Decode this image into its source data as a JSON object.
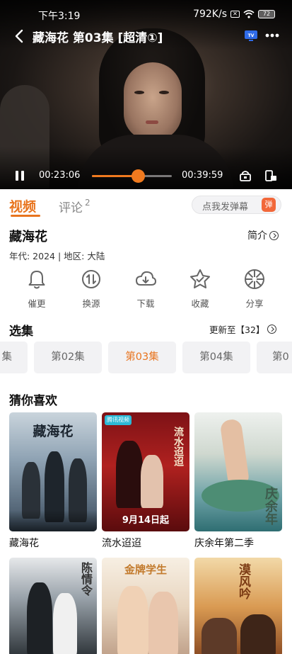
{
  "status_bar": {
    "time": "下午3:19",
    "net_speed": "792K/s",
    "battery": "72"
  },
  "player": {
    "title": "藏海花 第03集 [超清①]",
    "current_time": "00:23:06",
    "total_time": "00:39:59",
    "progress": 0.578,
    "tv_label": "TV"
  },
  "tabs": {
    "video": "视频",
    "comments": "评论",
    "comments_count": "2",
    "danmaku_placeholder": "点我发弹幕",
    "danmaku_icon": "弹"
  },
  "show": {
    "title": "藏海花",
    "intro_label": "简介",
    "meta": "年代: 2024 | 地区: 大陆"
  },
  "actions": [
    {
      "label": "催更",
      "icon": "bell-icon"
    },
    {
      "label": "换源",
      "icon": "switch-source-icon"
    },
    {
      "label": "下载",
      "icon": "cloud-download-icon"
    },
    {
      "label": "收藏",
      "icon": "star-icon"
    },
    {
      "label": "分享",
      "icon": "shutter-share-icon"
    }
  ],
  "episodes": {
    "title": "选集",
    "update_label": "更新至【32】",
    "items": [
      "集",
      "第02集",
      "第03集",
      "第04集",
      "第0"
    ],
    "active_index": 2
  },
  "recommendations": {
    "title": "猜你喜欢",
    "items": [
      {
        "name": "藏海花",
        "poster_text": "藏海花",
        "poster_caption": ""
      },
      {
        "name": "流水迢迢",
        "poster_text": "流水迢迢",
        "poster_caption": "9月14日起",
        "badge": "腾讯视频"
      },
      {
        "name": "庆余年第二季",
        "poster_text": "庆余年",
        "poster_caption": ""
      },
      {
        "name": "",
        "poster_text": "陈情令",
        "poster_caption": ""
      },
      {
        "name": "",
        "poster_text": "金牌学生",
        "poster_caption": ""
      },
      {
        "name": "",
        "poster_text": "漠风吟",
        "poster_caption": ""
      }
    ]
  },
  "colors": {
    "accent": "#e8741e",
    "danmaku_icon": "#f2683a"
  }
}
